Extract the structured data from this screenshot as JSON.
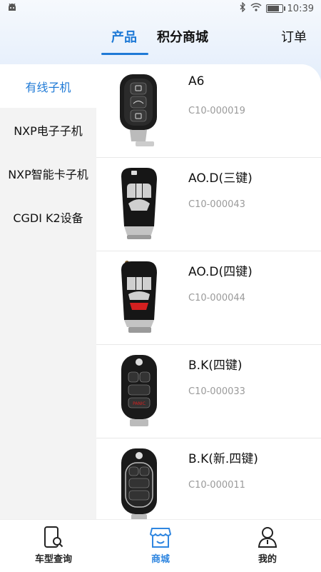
{
  "status_bar": {
    "time": "10:39"
  },
  "tabs": [
    {
      "label": "产品",
      "active": true
    },
    {
      "label": "积分商城",
      "active": false
    },
    {
      "label": "订单",
      "active": false
    }
  ],
  "sidebar": {
    "items": [
      {
        "label": "有线子机",
        "active": true
      },
      {
        "label": "NXP电子子机",
        "active": false
      },
      {
        "label": "NXP智能卡子机",
        "active": false
      },
      {
        "label": "CGDI K2设备",
        "active": false
      }
    ]
  },
  "products": [
    {
      "name": "A6",
      "code": "C10-000019",
      "icon": "flip-key-3-button-icon"
    },
    {
      "name": "AO.D(三键)",
      "code": "C10-000043",
      "icon": "flip-key-3-button-silver-icon"
    },
    {
      "name": "AO.D(四键)",
      "code": "C10-000044",
      "icon": "flip-key-4-button-red-icon"
    },
    {
      "name": "B.K(四键)",
      "code": "C10-000033",
      "icon": "flip-key-4-button-icon"
    },
    {
      "name": "B.K(新.四键)",
      "code": "C10-000011",
      "icon": "flip-key-4-button-new-icon"
    }
  ],
  "bottom_nav": [
    {
      "label": "车型查询",
      "icon": "phone-search-icon",
      "active": false
    },
    {
      "label": "商城",
      "icon": "store-icon",
      "active": true
    },
    {
      "label": "我的",
      "icon": "user-icon",
      "active": false
    }
  ],
  "colors": {
    "accent": "#1f7ad6",
    "nav_active": "#2f86e0",
    "code_gray": "#9a9a9a"
  }
}
